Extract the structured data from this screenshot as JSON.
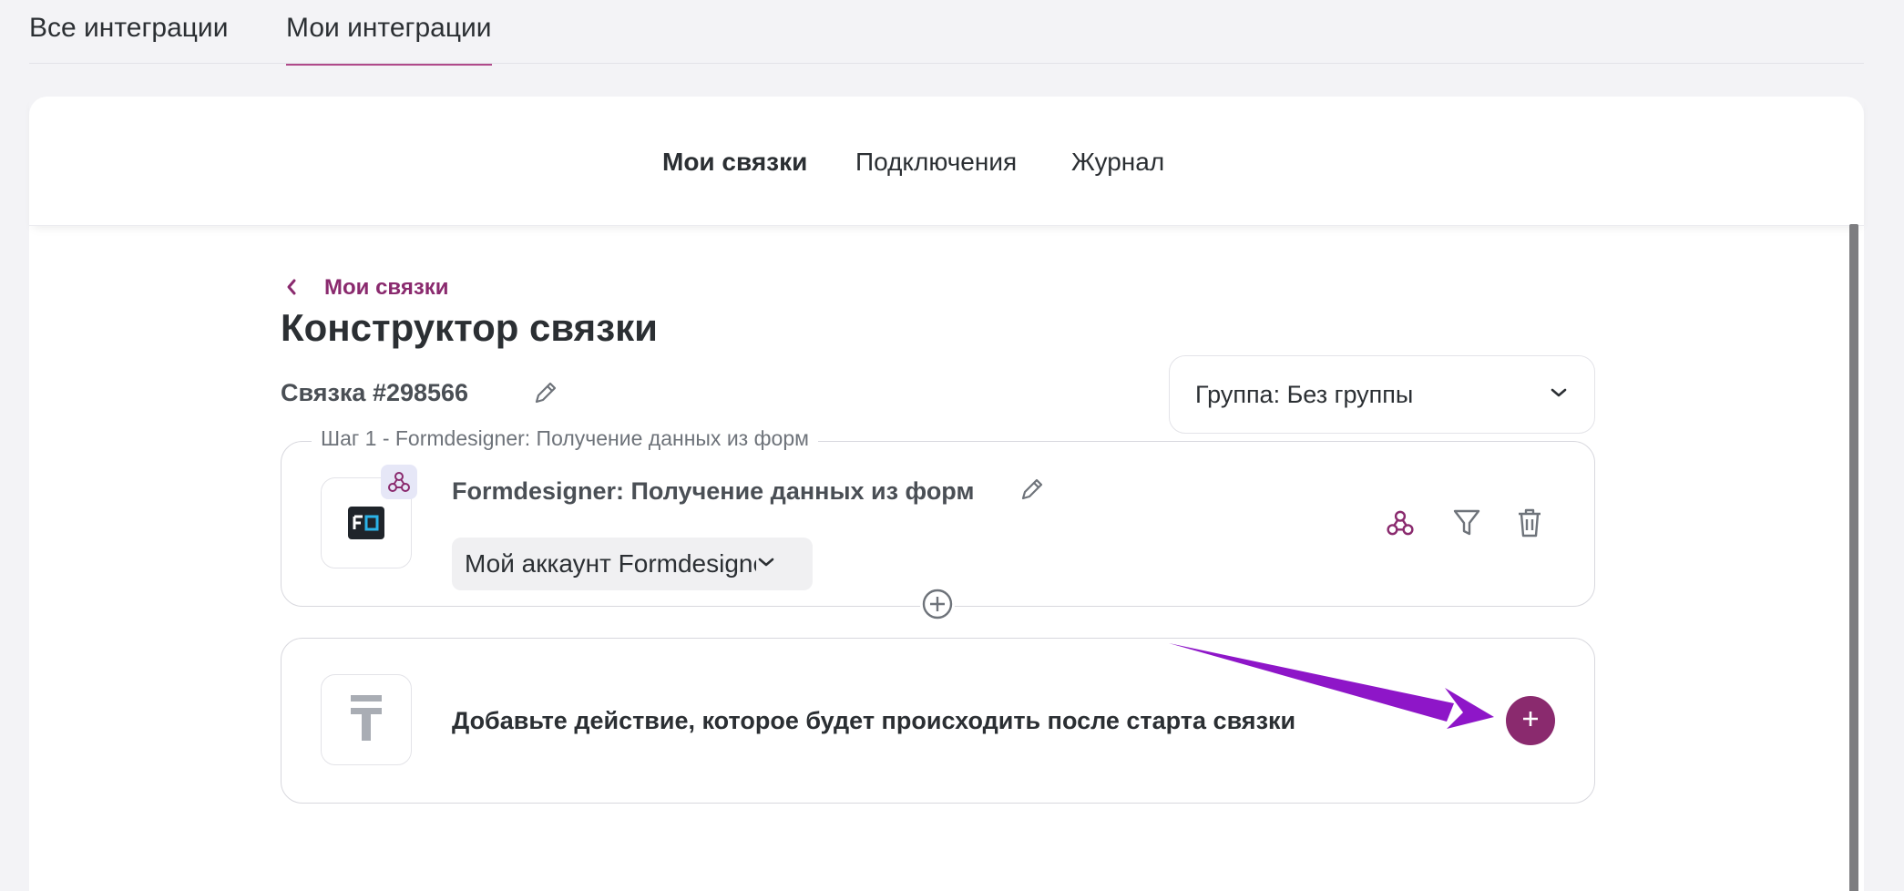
{
  "top_tabs": [
    {
      "label": "Все интеграции"
    },
    {
      "label": "Мои интеграции"
    }
  ],
  "sub_nav": [
    {
      "label": "Мои связки"
    },
    {
      "label": "Подключения"
    },
    {
      "label": "Журнал"
    }
  ],
  "breadcrumb": {
    "label": "Мои связки"
  },
  "page_title": "Конструктор связки",
  "link_id": "Связка #298566",
  "group_select": {
    "value": "Группа: Без группы"
  },
  "step": {
    "legend": "Шаг 1 - Formdesigner: Получение данных из форм",
    "title": "Formdesigner: Получение данных из форм",
    "account": "Мой аккаунт Formdesigner"
  },
  "action": {
    "text": "Добавьте действие, которое будет происходить после старта связки"
  },
  "colors": {
    "accent": "#8a2a6e",
    "arrow": "#8e16c8",
    "icon_accent": "#8a2a6e"
  }
}
